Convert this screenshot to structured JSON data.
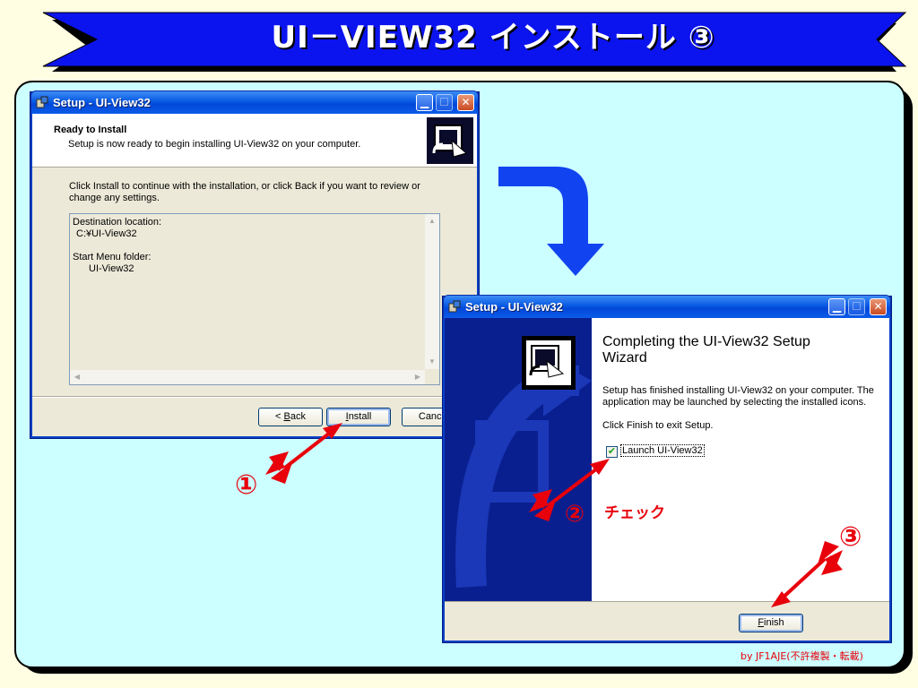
{
  "banner": {
    "title": "UI－VIEW32 インストール ③"
  },
  "window1": {
    "title": "Setup - UI-View32",
    "header_title": "Ready to Install",
    "header_subtitle": "Setup is now ready to begin installing UI-View32 on your computer.",
    "instruction_line1": "Click Install to continue with the installation, or click Back if you want to review or",
    "instruction_line2": "change any settings.",
    "dest_label": "Destination location:",
    "dest_value": "C:¥UI-View32",
    "menu_label": "Start Menu folder:",
    "menu_value": "UI-View32",
    "back_button": {
      "prefix": "< ",
      "accel": "B",
      "rest": "ack"
    },
    "install_button": {
      "accel": "I",
      "rest": "nstall"
    },
    "cancel_button": "Cancel"
  },
  "window2": {
    "title": "Setup - UI-View32",
    "heading_line1": "Completing the UI-View32 Setup",
    "heading_line2": "Wizard",
    "body_line1": "Setup has finished installing UI-View32 on your computer. The",
    "body_line2": "application may be launched by selecting the installed icons.",
    "body_line3": "Click Finish to exit Setup.",
    "checkbox_label": "Launch UI-View32",
    "checkbox_checked": true,
    "finish_button": {
      "accel": "F",
      "rest": "inish"
    }
  },
  "annotations": {
    "step1": "①",
    "step2": "②",
    "step2_note": "チェック",
    "step3": "③"
  },
  "footer": {
    "credit": "by JF1AJE(不許複製・転載)"
  },
  "colors": {
    "banner_blue": "#0b14ee",
    "panel_cyan": "#ccffff",
    "page_cream": "#fffde2",
    "annotation_red": "#e8000b",
    "xp_title_blue": "#0758e3",
    "xp_face": "#ece9d8",
    "curved_arrow_blue": "#1144f0"
  }
}
